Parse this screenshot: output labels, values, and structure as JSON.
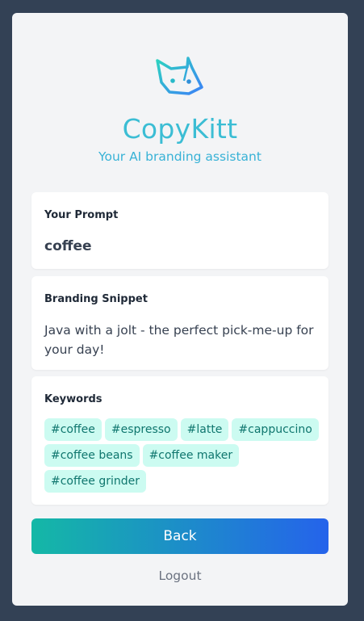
{
  "app": {
    "title": "CopyKitt",
    "subtitle": "Your AI branding assistant",
    "logo_icon": "cat-head-icon"
  },
  "prompt": {
    "label": "Your Prompt",
    "value": "coffee"
  },
  "snippet": {
    "label": "Branding Snippet",
    "text": "Java with a jolt - the perfect pick-me-up for your day!"
  },
  "keywords": {
    "label": "Keywords",
    "items": [
      "#coffee",
      "#espresso",
      "#latte",
      "#cappuccino",
      "#coffee beans",
      "#coffee maker",
      "#coffee grinder"
    ]
  },
  "actions": {
    "back_label": "Back",
    "logout_label": "Logout"
  },
  "colors": {
    "background": "#334155",
    "card": "#f3f4f6",
    "brand": "#3bbdd4",
    "chip_bg": "#ccfbf1",
    "chip_text": "#0f766e",
    "button_gradient_start": "#14b8a6",
    "button_gradient_end": "#2563eb"
  }
}
